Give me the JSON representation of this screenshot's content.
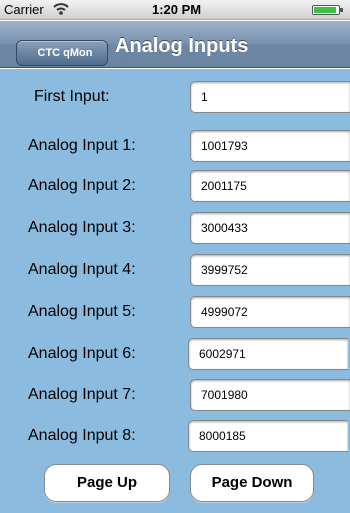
{
  "status_bar": {
    "carrier": "Carrier",
    "time": "1:20 PM"
  },
  "nav": {
    "back_label": "CTC qMon",
    "title": "Analog Inputs"
  },
  "first_input": {
    "label": "First Input:",
    "value": "1"
  },
  "inputs": [
    {
      "label": "Analog Input 1:",
      "value": "1001793"
    },
    {
      "label": "Analog Input 2:",
      "value": "2001175"
    },
    {
      "label": "Analog Input 3:",
      "value": "3000433"
    },
    {
      "label": "Analog Input 4:",
      "value": "3999752"
    },
    {
      "label": "Analog Input 5:",
      "value": "4999072"
    },
    {
      "label": "Analog Input 6:",
      "value": "6002971"
    },
    {
      "label": "Analog Input 7:",
      "value": "7001980"
    },
    {
      "label": "Analog Input 8:",
      "value": "8000185"
    }
  ],
  "buttons": {
    "page_up": "Page Up",
    "page_down": "Page Down"
  },
  "colors": {
    "background": "#8bbcdf",
    "nav_bar": "#6d87a5",
    "battery": "#3fbf3f"
  },
  "icons": {
    "wifi": "wifi-icon",
    "battery": "battery-icon"
  },
  "battery_level": 0.9
}
